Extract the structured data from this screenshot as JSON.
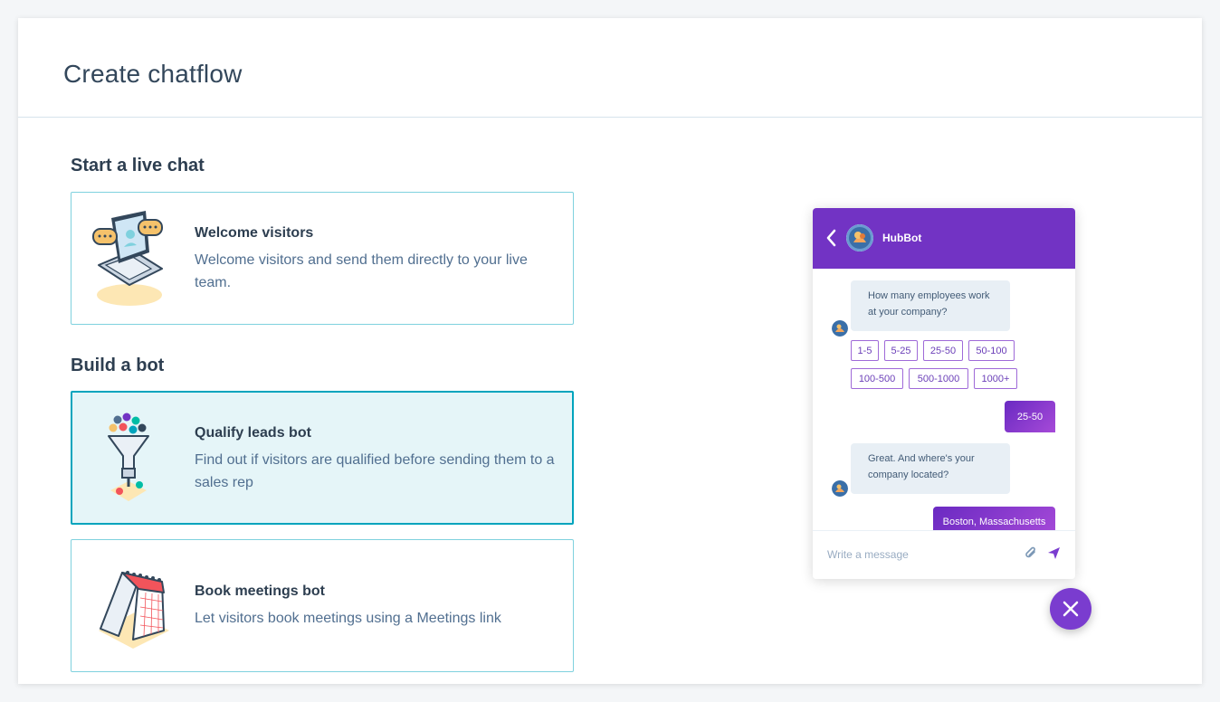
{
  "page": {
    "title": "Create chatflow"
  },
  "sections": {
    "live_chat": {
      "heading": "Start a live chat",
      "cards": [
        {
          "title": "Welcome visitors",
          "description": "Welcome visitors and send them directly to your live team.",
          "icon": "laptop-chat-illustration"
        }
      ]
    },
    "bot": {
      "heading": "Build a bot",
      "cards": [
        {
          "title": "Qualify leads bot",
          "description": "Find out if visitors are qualified before sending them to a sales rep",
          "icon": "funnel-illustration",
          "selected": true
        },
        {
          "title": "Book meetings bot",
          "description": "Let visitors book meetings using a Meetings link",
          "icon": "calendar-illustration"
        }
      ]
    }
  },
  "chat_preview": {
    "bot_name": "HubBot",
    "messages": [
      {
        "from": "bot",
        "text": "How many employees work at your company?"
      },
      {
        "from": "user",
        "text": "25-50"
      },
      {
        "from": "bot",
        "text": "Great. And where's your company located?"
      },
      {
        "from": "user",
        "text": "Boston, Massachusetts"
      }
    ],
    "options": [
      "1-5",
      "5-25",
      "25-50",
      "50-100",
      "100-500",
      "500-1000",
      "1000+"
    ],
    "input_placeholder": "Write a message",
    "header_color": "#7233c4"
  },
  "colors": {
    "accent": "#00a4bd",
    "selected_bg": "#e5f5f8",
    "card_border": "#7fd1de",
    "bot_purple": "#7a3ccf"
  }
}
